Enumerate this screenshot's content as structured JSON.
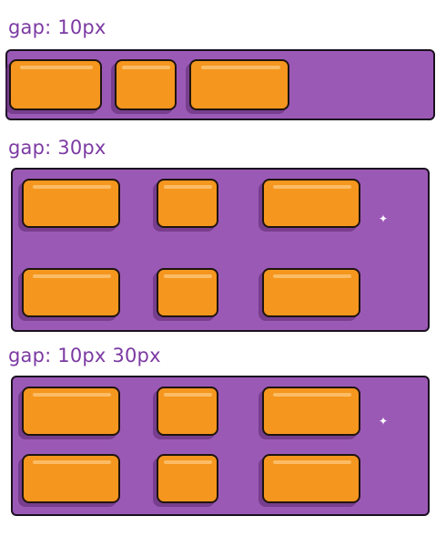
{
  "labels": {
    "gap_single": "gap: 10px",
    "gap_both": "gap: 30px",
    "gap_row_col": "gap: 10px 30px"
  },
  "colors": {
    "label_text": "#7c3aa3",
    "container_fill": "#9b59b6",
    "item_fill": "#f5961e",
    "outline": "#1a1020"
  }
}
